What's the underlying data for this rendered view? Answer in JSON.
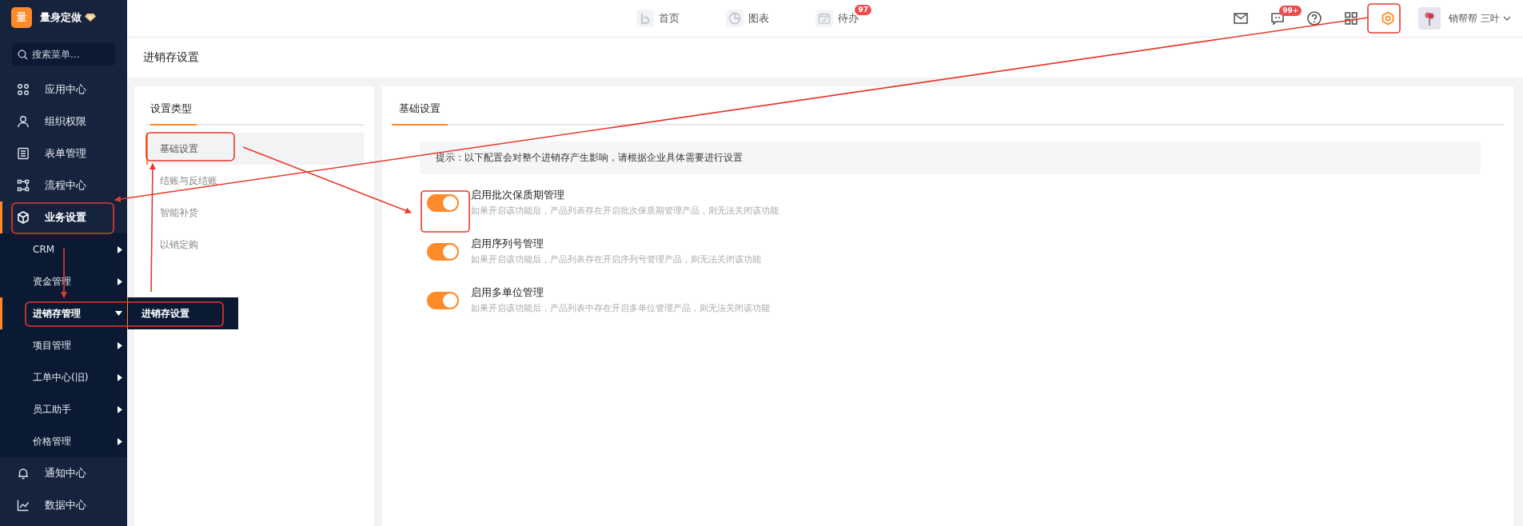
{
  "brand": {
    "logo": "量",
    "name": "量身定做"
  },
  "search": {
    "placeholder": "搜索菜单..."
  },
  "sidebar": {
    "items": [
      {
        "label": "应用中心",
        "selected": false
      },
      {
        "label": "组织权限",
        "selected": false
      },
      {
        "label": "表单管理",
        "selected": false
      },
      {
        "label": "流程中心",
        "selected": false
      },
      {
        "label": "业务设置",
        "selected": true,
        "children": [
          {
            "label": "CRM",
            "selected": false,
            "expanded": false
          },
          {
            "label": "资金管理",
            "selected": false,
            "expanded": false
          },
          {
            "label": "进销存管理",
            "selected": true,
            "expanded": true,
            "children": [
              {
                "label": "进销存设置",
                "selected": true
              }
            ]
          },
          {
            "label": "项目管理",
            "selected": false,
            "expanded": false
          },
          {
            "label": "工单中心(旧)",
            "selected": false,
            "expanded": false
          },
          {
            "label": "员工助手",
            "selected": false,
            "expanded": false
          },
          {
            "label": "价格管理",
            "selected": false,
            "expanded": false
          }
        ]
      },
      {
        "label": "通知中心",
        "selected": false
      },
      {
        "label": "数据中心",
        "selected": false
      }
    ]
  },
  "top_nav": [
    {
      "label": "首页"
    },
    {
      "label": "图表"
    },
    {
      "label": "待办",
      "badge": "97"
    }
  ],
  "toolbar": [
    {
      "kind": "mail"
    },
    {
      "kind": "chat",
      "badge": "99+"
    },
    {
      "kind": "help"
    },
    {
      "kind": "apps"
    },
    {
      "kind": "settings",
      "selected": true
    }
  ],
  "user": {
    "name": "销帮帮 三叶"
  },
  "page_title": "进销存设置",
  "settings_types": {
    "title": "设置类型",
    "items": [
      {
        "label": "基础设置",
        "selected": true
      },
      {
        "label": "结账与反结账",
        "selected": false
      },
      {
        "label": "智能补货",
        "selected": false
      },
      {
        "label": "以销定购",
        "selected": false
      }
    ]
  },
  "tabs": [
    {
      "label": "基础设置",
      "selected": true
    }
  ],
  "notice": "提示：以下配置会对整个进销存产生影响，请根据企业具体需要进行设置",
  "options": [
    {
      "title": "启用批次保质期管理",
      "description": "如果开启该功能后，产品列表存在开启批次保质期管理产品，则无法关闭该功能",
      "on": true
    },
    {
      "title": "启用序列号管理",
      "description": "如果开启该功能后，产品列表存在开启序列号管理产品，则无法关闭该功能",
      "on": true
    },
    {
      "title": "启用多单位管理",
      "description": "如果开启该功能后，产品列表中存在开启多单位管理产品，则无法关闭该功能",
      "on": true
    }
  ]
}
